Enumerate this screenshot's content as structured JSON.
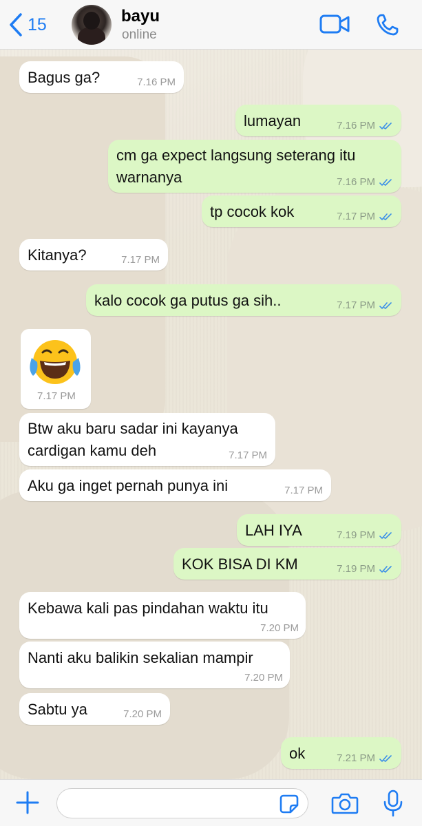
{
  "header": {
    "back_count": "15",
    "contact_name": "bayu",
    "contact_status": "online",
    "icons": {
      "back": "chevron-left-icon",
      "video": "video-camera-icon",
      "call": "phone-icon"
    },
    "accent_color": "#1e7cf3"
  },
  "messages": [
    {
      "dir": "in",
      "text": "Bagus ga?",
      "time": "7.16 PM"
    },
    {
      "dir": "out",
      "text": "lumayan",
      "time": "7.16 PM",
      "read": true
    },
    {
      "dir": "out",
      "text_line1": "cm ga expect langsung seterang itu",
      "text_line2": "warnanya",
      "time": "7.16 PM",
      "read": true
    },
    {
      "dir": "out",
      "text": "tp cocok kok",
      "time": "7.17 PM",
      "read": true
    },
    {
      "dir": "in",
      "text": "Kitanya?",
      "time": "7.17 PM"
    },
    {
      "dir": "out",
      "text": "kalo cocok ga putus ga sih..",
      "time": "7.17 PM",
      "read": true
    },
    {
      "dir": "in",
      "emoji": "face-with-tears-of-joy",
      "time": "7.17 PM"
    },
    {
      "dir": "in",
      "text_line1": "Btw aku baru sadar ini kayanya",
      "text_line2": "cardigan kamu deh",
      "time": "7.17 PM"
    },
    {
      "dir": "in",
      "text": "Aku ga inget pernah punya ini",
      "time": "7.17 PM"
    },
    {
      "dir": "out",
      "text": "LAH IYA",
      "time": "7.19 PM",
      "read": true
    },
    {
      "dir": "out",
      "text": "KOK BISA DI KM",
      "time": "7.19 PM",
      "read": true
    },
    {
      "dir": "in",
      "text": "Kebawa kali pas pindahan waktu itu",
      "time": "7.20 PM"
    },
    {
      "dir": "in",
      "text": "Nanti aku balikin sekalian mampir",
      "time": "7.20 PM"
    },
    {
      "dir": "in",
      "text": "Sabtu ya",
      "time": "7.20 PM"
    },
    {
      "dir": "out",
      "text": "ok",
      "time": "7.21 PM",
      "read": true
    }
  ],
  "colors": {
    "bubble_in": "#ffffff",
    "bubble_out": "#dcf7c5",
    "tick_read": "#3b8fe8"
  },
  "composer": {
    "placeholder": "",
    "icons": {
      "plus": "plus-icon",
      "sticker": "sticker-icon",
      "camera": "camera-icon",
      "mic": "microphone-icon"
    }
  }
}
